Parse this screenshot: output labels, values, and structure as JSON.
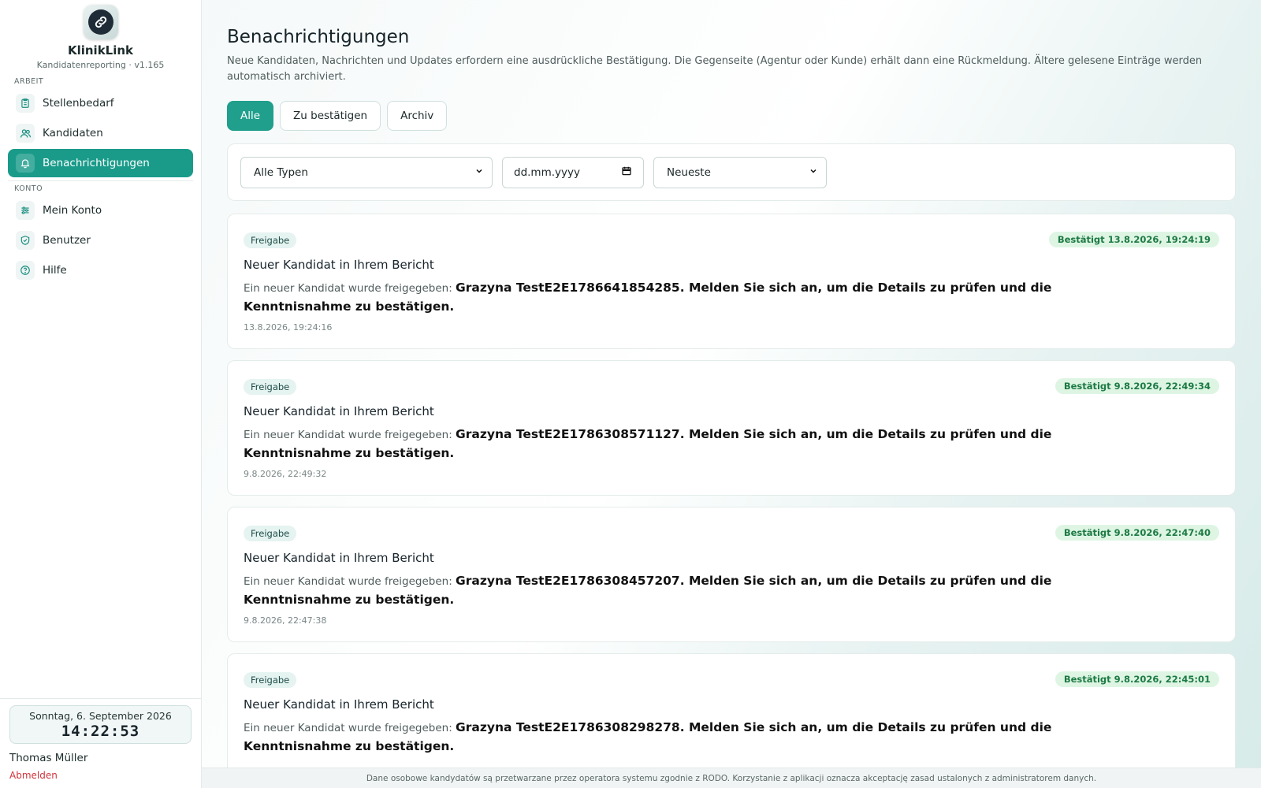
{
  "brand": {
    "name": "KlinikLink",
    "subtitle": "Kandidatenreporting · v1.165",
    "logo_icon": "link-icon"
  },
  "sidebar": {
    "section_work": "ARBEIT",
    "section_account": "KONTO",
    "items": [
      {
        "label": "Stellenbedarf",
        "icon": "clipboard-icon"
      },
      {
        "label": "Kandidaten",
        "icon": "users-icon"
      },
      {
        "label": "Benachrichtigungen",
        "icon": "bell-icon",
        "active": true
      },
      {
        "label": "Mein Konto",
        "icon": "sliders-icon"
      },
      {
        "label": "Benutzer",
        "icon": "shield-check-icon"
      },
      {
        "label": "Hilfe",
        "icon": "help-circle-icon"
      }
    ],
    "date": "Sonntag, 6. September 2026",
    "time": "14:22:53",
    "user": "Thomas Müller",
    "logout": "Abmelden"
  },
  "page": {
    "title": "Benachrichtigungen",
    "description": "Neue Kandidaten, Nachrichten und Updates erfordern eine ausdrückliche Bestätigung. Die Gegenseite (Agentur oder Kunde) erhält dann eine Rückmeldung. Ältere gelesene Einträge werden automatisch archiviert.",
    "tabs": [
      "Alle",
      "Zu bestätigen",
      "Archiv"
    ],
    "active_tab": "Alle"
  },
  "filters": {
    "type": "Alle Typen",
    "date_placeholder": "dd.mm.yyyy",
    "sort": "Neueste"
  },
  "notifications": [
    {
      "type": "Freigabe",
      "status": "Bestätigt 13.8.2026, 19:24:19",
      "title": "Neuer Kandidat in Ihrem Bericht",
      "intro": "Ein neuer Kandidat wurde freigegeben: ",
      "bold": "Grazyna TestE2E1786641854285. Melden Sie sich an, um die Details zu prüfen und die Kenntnisnahme zu bestätigen.",
      "time": "13.8.2026, 19:24:16"
    },
    {
      "type": "Freigabe",
      "status": "Bestätigt 9.8.2026, 22:49:34",
      "title": "Neuer Kandidat in Ihrem Bericht",
      "intro": "Ein neuer Kandidat wurde freigegeben: ",
      "bold": "Grazyna TestE2E1786308571127. Melden Sie sich an, um die Details zu prüfen und die Kenntnisnahme zu bestätigen.",
      "time": "9.8.2026, 22:49:32"
    },
    {
      "type": "Freigabe",
      "status": "Bestätigt 9.8.2026, 22:47:40",
      "title": "Neuer Kandidat in Ihrem Bericht",
      "intro": "Ein neuer Kandidat wurde freigegeben: ",
      "bold": "Grazyna TestE2E1786308457207. Melden Sie sich an, um die Details zu prüfen und die Kenntnisnahme zu bestätigen.",
      "time": "9.8.2026, 22:47:38"
    },
    {
      "type": "Freigabe",
      "status": "Bestätigt 9.8.2026, 22:45:01",
      "title": "Neuer Kandidat in Ihrem Bericht",
      "intro": "Ein neuer Kandidat wurde freigegeben: ",
      "bold": "Grazyna TestE2E1786308298278. Melden Sie sich an, um die Details zu prüfen und die Kenntnisnahme zu bestätigen.",
      "time": ""
    }
  ],
  "footer": "Dane osobowe kandydatów są przetwarzane przez operatora systemu zgodnie z RODO. Korzystanie z aplikacji oznacza akceptację zasad ustalonych z administratorem danych.",
  "colors": {
    "accent": "#1a9b8a",
    "status_bg": "#def5e4",
    "status_text": "#1c7a43",
    "logout": "#d0343b"
  }
}
